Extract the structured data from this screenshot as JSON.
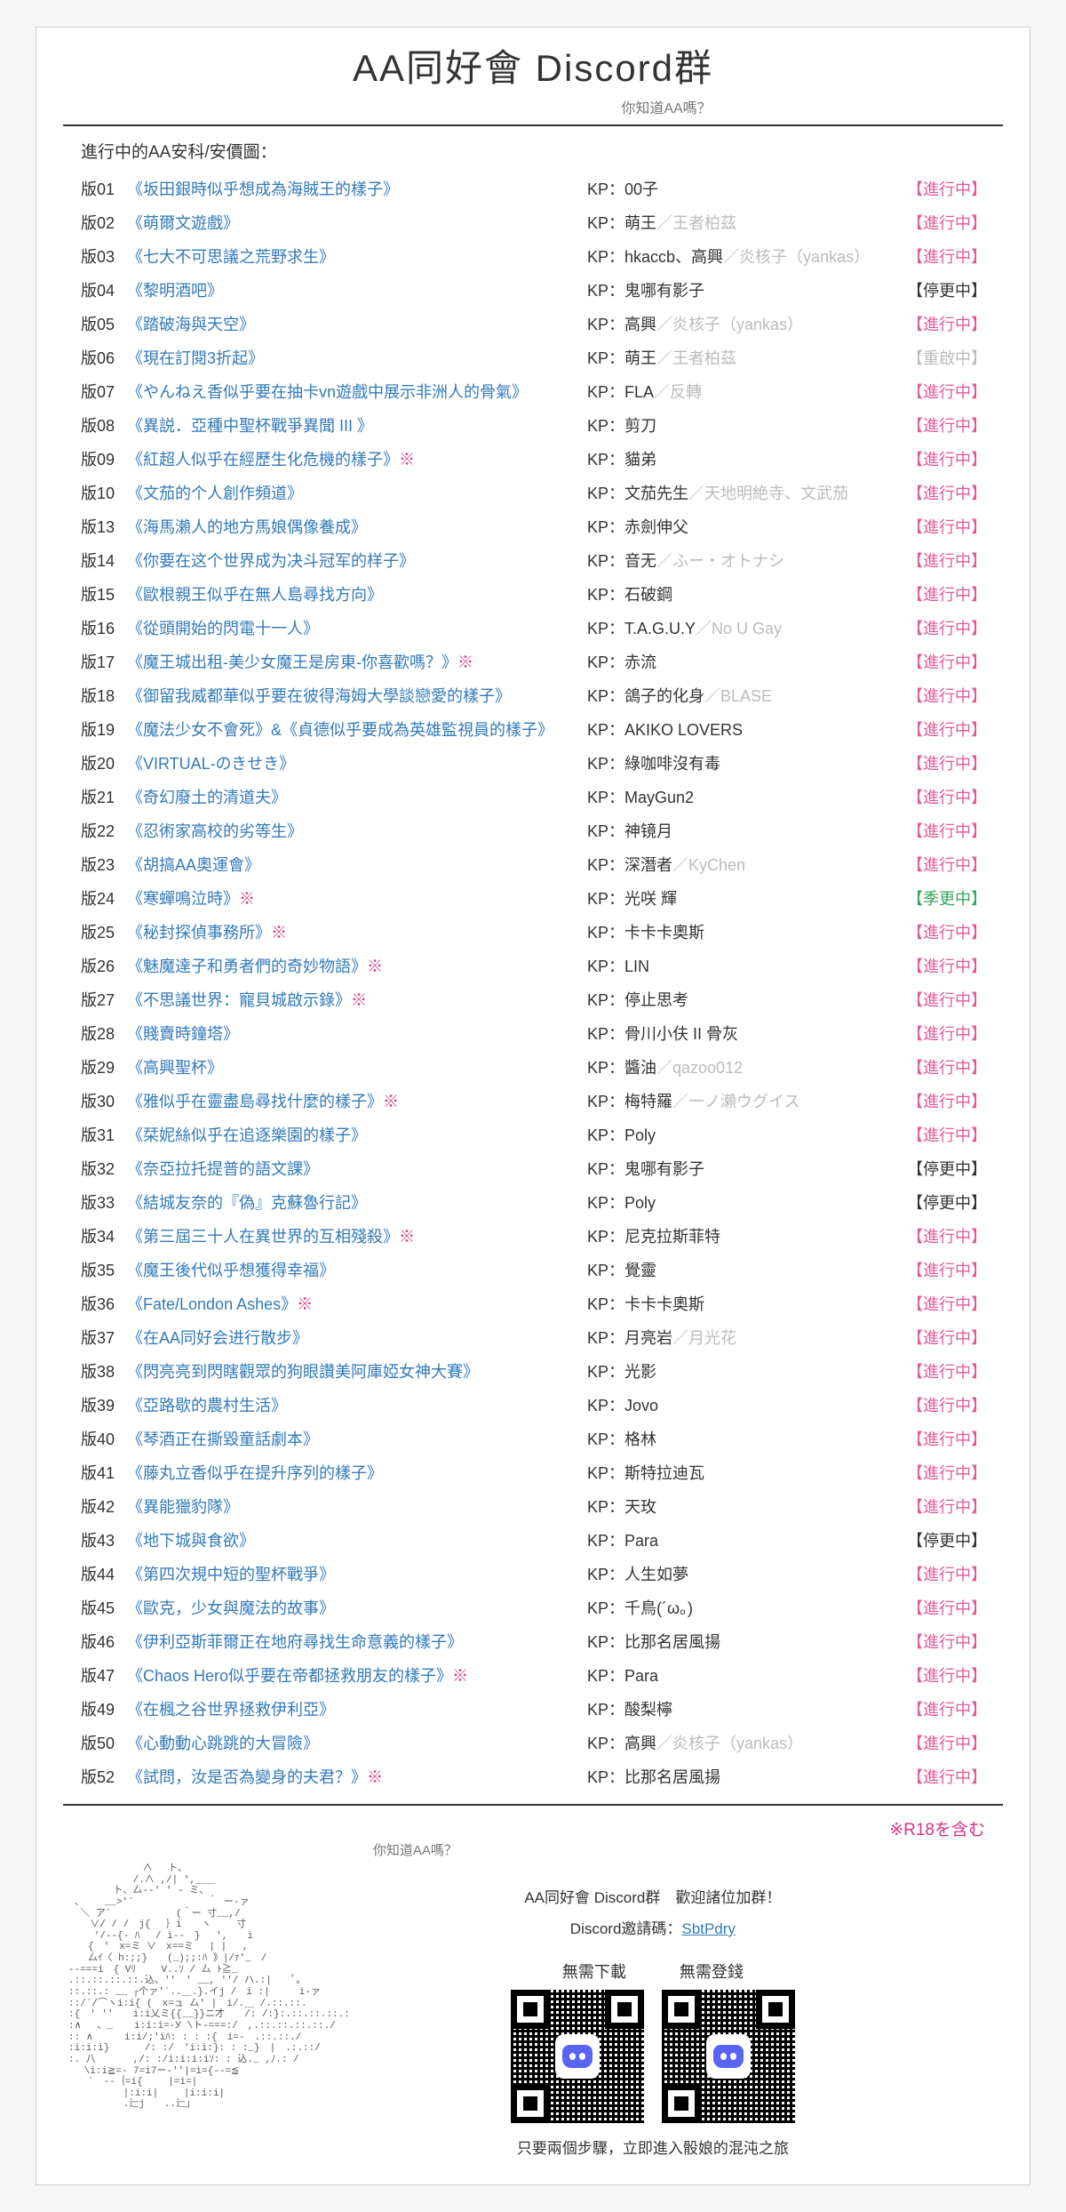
{
  "header": {
    "title": "AA同好會 Discord群",
    "subtitle": "你知道AA嗎？"
  },
  "section_label": "進行中的AA安科/安價圖：",
  "kp_prefix": "KP：",
  "rows": [
    {
      "ver": "版01",
      "title": "《坂田銀時似乎想成為海賊王的樣子》",
      "kp": "00子",
      "kp_extra": "",
      "status": "【進行中】",
      "status_cls": "progress"
    },
    {
      "ver": "版02",
      "title": "《萌爾文遊戲》",
      "kp": "萌王",
      "kp_extra": "／王者柏茲",
      "status": "【進行中】",
      "status_cls": "progress"
    },
    {
      "ver": "版03",
      "title": "《七大不可思議之荒野求生》",
      "kp": "hkaccb、高興",
      "kp_extra": "／炎核子（yankas）",
      "status": "【進行中】",
      "status_cls": "progress"
    },
    {
      "ver": "版04",
      "title": "《黎明酒吧》",
      "kp": "鬼哪有影子",
      "kp_extra": "",
      "status": "【停更中】",
      "status_cls": "paused"
    },
    {
      "ver": "版05",
      "title": "《踏破海與天空》",
      "kp": "高興",
      "kp_extra": "／炎核子（yankas）",
      "status": "【進行中】",
      "status_cls": "progress"
    },
    {
      "ver": "版06",
      "title": "《現在訂閱3折起》",
      "kp": "萌王",
      "kp_extra": "／王者柏茲",
      "status": "【重啟中】",
      "status_cls": "reboot"
    },
    {
      "ver": "版07",
      "title": "《やんねえ香似乎要在抽卡vn遊戲中展示非洲人的骨氣》",
      "kp": "FLA",
      "kp_extra": "／反轉",
      "status": "【進行中】",
      "status_cls": "progress"
    },
    {
      "ver": "版08",
      "title": "《異説．亞種中聖杯戰爭異聞 III 》",
      "kp": "剪刀",
      "kp_extra": "",
      "status": "【進行中】",
      "status_cls": "progress"
    },
    {
      "ver": "版09",
      "title": "《紅超人似乎在經歷生化危機的樣子》",
      "r18": true,
      "kp": "貓弟",
      "kp_extra": "",
      "status": "【進行中】",
      "status_cls": "progress"
    },
    {
      "ver": "版10",
      "title": "《文茄的个人創作頻道》",
      "kp": "文茄先生",
      "kp_extra": "／天地明絶寺、文武茄",
      "status": "【進行中】",
      "status_cls": "progress"
    },
    {
      "ver": "版13",
      "title": "《海馬瀨人的地方馬娘偶像養成》",
      "kp": "赤劍伸父",
      "kp_extra": "",
      "status": "【進行中】",
      "status_cls": "progress"
    },
    {
      "ver": "版14",
      "title": "《你要在这个世界成为决斗冠军的样子》",
      "kp": "音无",
      "kp_extra": "／ふー・オトナシ",
      "status": "【進行中】",
      "status_cls": "progress"
    },
    {
      "ver": "版15",
      "title": "《歐根親王似乎在無人島尋找方向》",
      "kp": "石破鋼",
      "kp_extra": "",
      "status": "【進行中】",
      "status_cls": "progress"
    },
    {
      "ver": "版16",
      "title": "《從頭開始的閃電十一人》",
      "kp": "T.A.G.U.Y",
      "kp_extra": "／No U Gay",
      "status": "【進行中】",
      "status_cls": "progress"
    },
    {
      "ver": "版17",
      "title": "《魔王城出租-美少女魔王是房東-你喜歡嗎？》",
      "r18": true,
      "kp": "赤流",
      "kp_extra": "",
      "status": "【進行中】",
      "status_cls": "progress"
    },
    {
      "ver": "版18",
      "title": "《御留我威都華似乎要在彼得海姆大學談戀愛的樣子》",
      "kp": "鴿子的化身",
      "kp_extra": "／BLASE",
      "status": "【進行中】",
      "status_cls": "progress"
    },
    {
      "ver": "版19",
      "title": "《魔法少女不會死》&《貞德似乎要成為英雄監視員的樣子》",
      "kp": "AKIKO LOVERS",
      "kp_extra": "",
      "status": "【進行中】",
      "status_cls": "progress"
    },
    {
      "ver": "版20",
      "title": "《VIRTUAL-のきせき》",
      "kp": "綠咖啡沒有毒",
      "kp_extra": "",
      "status": "【進行中】",
      "status_cls": "progress"
    },
    {
      "ver": "版21",
      "title": "《奇幻廢土的清道夫》",
      "kp": "MayGun2",
      "kp_extra": "",
      "status": "【進行中】",
      "status_cls": "progress"
    },
    {
      "ver": "版22",
      "title": "《忍術家高校的劣等生》",
      "kp": "神镜月",
      "kp_extra": "",
      "status": "【進行中】",
      "status_cls": "progress"
    },
    {
      "ver": "版23",
      "title": "《胡搞AA奧運會》",
      "kp": "深潛者",
      "kp_extra": "／KyChen",
      "status": "【進行中】",
      "status_cls": "progress"
    },
    {
      "ver": "版24",
      "title": "《寒蟬鳴泣時》",
      "r18": true,
      "kp": "光咲 輝",
      "kp_extra": "",
      "status": "【季更中】",
      "status_cls": "season"
    },
    {
      "ver": "版25",
      "title": "《秘封探偵事務所》",
      "r18": true,
      "kp": "卡卡卡奧斯",
      "kp_extra": "",
      "status": "【進行中】",
      "status_cls": "progress"
    },
    {
      "ver": "版26",
      "title": "《魅魔達子和勇者們的奇妙物語》",
      "r18": true,
      "kp": "LIN",
      "kp_extra": "",
      "status": "【進行中】",
      "status_cls": "progress"
    },
    {
      "ver": "版27",
      "title": "《不思議世界：寵貝城啟示錄》",
      "r18": true,
      "kp": "停止思考",
      "kp_extra": "",
      "status": "【進行中】",
      "status_cls": "progress"
    },
    {
      "ver": "版28",
      "title": "《賤賣時鐘塔》",
      "kp": "骨川小伕 II 骨灰",
      "kp_extra": "",
      "status": "【進行中】",
      "status_cls": "progress"
    },
    {
      "ver": "版29",
      "title": "《高興聖杯》",
      "kp": "醬油",
      "kp_extra": "／qazoo012",
      "status": "【進行中】",
      "status_cls": "progress"
    },
    {
      "ver": "版30",
      "title": "《雅似乎在靈盡島尋找什麼的樣子》",
      "r18": true,
      "kp": "梅特羅",
      "kp_extra": "／一ノ瀨ウグイス",
      "status": "【進行中】",
      "status_cls": "progress"
    },
    {
      "ver": "版31",
      "title": "《栞妮絲似乎在追逐樂園的樣子》",
      "kp": "Poly",
      "kp_extra": "",
      "status": "【進行中】",
      "status_cls": "progress"
    },
    {
      "ver": "版32",
      "title": "《奈亞拉托提普的語文課》",
      "kp": "鬼哪有影子",
      "kp_extra": "",
      "status": "【停更中】",
      "status_cls": "paused"
    },
    {
      "ver": "版33",
      "title": "《結城友奈的『偽』克蘇魯行記》",
      "kp": "Poly",
      "kp_extra": "",
      "status": "【停更中】",
      "status_cls": "paused"
    },
    {
      "ver": "版34",
      "title": "《第三屆三十人在異世界的互相殘殺》",
      "r18": true,
      "kp": "尼克拉斯菲特",
      "kp_extra": "",
      "status": "【進行中】",
      "status_cls": "progress"
    },
    {
      "ver": "版35",
      "title": "《魔王後代似乎想獲得幸福》",
      "kp": "覺靈",
      "kp_extra": "",
      "status": "【進行中】",
      "status_cls": "progress"
    },
    {
      "ver": "版36",
      "title": "《Fate/London Ashes》",
      "r18": true,
      "kp": "卡卡卡奧斯",
      "kp_extra": "",
      "status": "【進行中】",
      "status_cls": "progress"
    },
    {
      "ver": "版37",
      "title": "《在AA同好会进行散步》",
      "kp": "月亮岩",
      "kp_extra": "／月光花",
      "status": "【進行中】",
      "status_cls": "progress"
    },
    {
      "ver": "版38",
      "title": "《閃亮亮到閃瞎觀眾的狗眼讚美阿庫婭女神大賽》",
      "kp": "光影",
      "kp_extra": "",
      "status": "【進行中】",
      "status_cls": "progress"
    },
    {
      "ver": "版39",
      "title": "《亞路歇的農村生活》",
      "kp": "Jovo",
      "kp_extra": "",
      "status": "【進行中】",
      "status_cls": "progress"
    },
    {
      "ver": "版40",
      "title": "《琴酒正在撕毀童話劇本》",
      "kp": "格林",
      "kp_extra": "",
      "status": "【進行中】",
      "status_cls": "progress"
    },
    {
      "ver": "版41",
      "title": "《藤丸立香似乎在提升序列的樣子》",
      "kp": "斯特拉迪瓦",
      "kp_extra": "",
      "status": "【進行中】",
      "status_cls": "progress"
    },
    {
      "ver": "版42",
      "title": "《異能獵豹隊》",
      "kp": "天玫",
      "kp_extra": "",
      "status": "【進行中】",
      "status_cls": "progress"
    },
    {
      "ver": "版43",
      "title": "《地下城與食欲》",
      "kp": "Para",
      "kp_extra": "",
      "status": "【停更中】",
      "status_cls": "paused"
    },
    {
      "ver": "版44",
      "title": "《第四次規中短的聖杯戰爭》",
      "kp": "人生如夢",
      "kp_extra": "",
      "status": "【進行中】",
      "status_cls": "progress"
    },
    {
      "ver": "版45",
      "title": "《歐克，少女與魔法的故事》",
      "kp": "千鳥(´ω。)",
      "kp_extra": "",
      "status": "【進行中】",
      "status_cls": "progress"
    },
    {
      "ver": "版46",
      "title": "《伊利亞斯菲爾正在地府尋找生命意義的樣子》",
      "kp": "比那名居風揚",
      "kp_extra": "",
      "status": "【進行中】",
      "status_cls": "progress"
    },
    {
      "ver": "版47",
      "title": "《Chaos Hero似乎要在帝都拯救朋友的樣子》",
      "r18": true,
      "kp": "Para",
      "kp_extra": "",
      "status": "【進行中】",
      "status_cls": "progress"
    },
    {
      "ver": "版49",
      "title": "《在楓之谷世界拯救伊利亞》",
      "kp": "酸梨檸",
      "kp_extra": "",
      "status": "【進行中】",
      "status_cls": "progress"
    },
    {
      "ver": "版50",
      "title": "《心動動心跳跳的大冒險》",
      "kp": "高興",
      "kp_extra": "／炎核子（yankas）",
      "status": "【進行中】",
      "status_cls": "progress"
    },
    {
      "ver": "版52",
      "title": "《試問，汝是否為變身的夫君？》",
      "r18": true,
      "kp": "比那名居風揚",
      "kp_extra": "",
      "status": "【進行中】",
      "status_cls": "progress"
    }
  ],
  "r18_legend": "※R18を含む",
  "r18_mark": "※",
  "promo": {
    "invite_line_a": "AA同好會 Discord群　歡迎諸位加群！",
    "invite_line_b_prefix": "Discord邀請碼：",
    "invite_code": "SbtPdry",
    "qr_no_download": "無需下載",
    "qr_no_register": "無需登錢",
    "caption": "只要兩個步驟，立即進入骰娘的混沌之旅"
  },
  "ascii_caption": "你知道AA嗎？",
  "ascii_art": "　　　　　　　 ∧　 ト、\n　　　　　　 /.∧ ,/| ',＿＿\n　　　　 ト、厶-‐' ' - ミ、\n 、　　 __>'´ 　　　　　　　｀ ー-ァ\n  ＼ ア´　　　　　　 (＾ー 寸__,/\n 　 ∨/ / /　j{　 ｝i　　ヽ　　 寸\n 　　′/-‐{- ﾊ　 / i‐-　}　 ',　　i\n　　{　'　x=ミ ∨　x==ミ　 | |　 ,\n　　厶ｲ〈 h:;;}　　(_);;:ﾊ 》|/ｧ'_　/\n-‐===i　{ Vﾘ　　 V..ｿ / 厶 ﾄ≧_\n.::.::.::.::.込、''　' __, ''/ ハ.:|　　ﾟ。\n::.::.: __ ┌个ァ'´..＿.}.イj /　i :|　　　i-ァ\n::/´/⌒ヽi:i{ (　x=ュ 厶' |　i/.＿ /.::.::.\n:{　′ ''　　i:i乂ミ{{__}}ニ才　　/: /:}:.::.::.::.:\n:∧　 、_　  i:i:i=-У \\ト-===:/　,.::.::.::.::./\n:: ∧　　  i:i/;′iﾊ: : : :{　i=-　.::.::./\n:i:i:i}　　　 /: :/　'i:i:}: : :_}　|　.:.::/\n:. 八　  　 ,/: :/i:i:i:iｿ: : 込._ ,ﾉ.: /\n　 \\i:i≧=- 7=i7ー‐''|=i={-‐=≦\n　　`　‐-｛=i{　　 |=i=|\n　　　 　　|:i:i|　　 |i:i:i|\n　　　　　 .辷j　　..辷｣"
}
